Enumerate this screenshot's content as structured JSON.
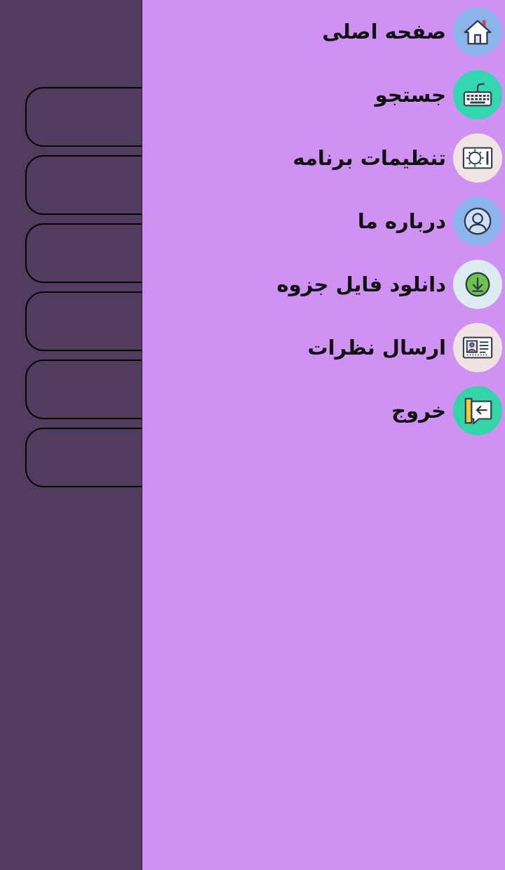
{
  "colors": {
    "background": "#513b5f",
    "drawer": "#cf92f3",
    "home_icon_bg": "#8cb4ec",
    "search_icon_bg": "#34d6b0",
    "settings_icon_bg": "#eee5e4",
    "about_icon_bg": "#8cb4ec",
    "download_icon_bg": "#dcecf1",
    "feedback_icon_bg": "#efe4e2",
    "exit_icon_bg": "#35d3a8"
  },
  "drawer": {
    "items": [
      {
        "label": "صفحه اصلی",
        "icon": "home-icon"
      },
      {
        "label": "جستجو",
        "icon": "keyboard-icon"
      },
      {
        "label": "تنظیمات برنامه",
        "icon": "settings-panel-icon"
      },
      {
        "label": "درباره ما",
        "icon": "user-icon"
      },
      {
        "label": "دانلود فایل جزوه",
        "icon": "download-icon"
      },
      {
        "label": "ارسال نظرات",
        "icon": "id-card-icon"
      },
      {
        "label": "خروج",
        "icon": "exit-icon"
      }
    ]
  }
}
